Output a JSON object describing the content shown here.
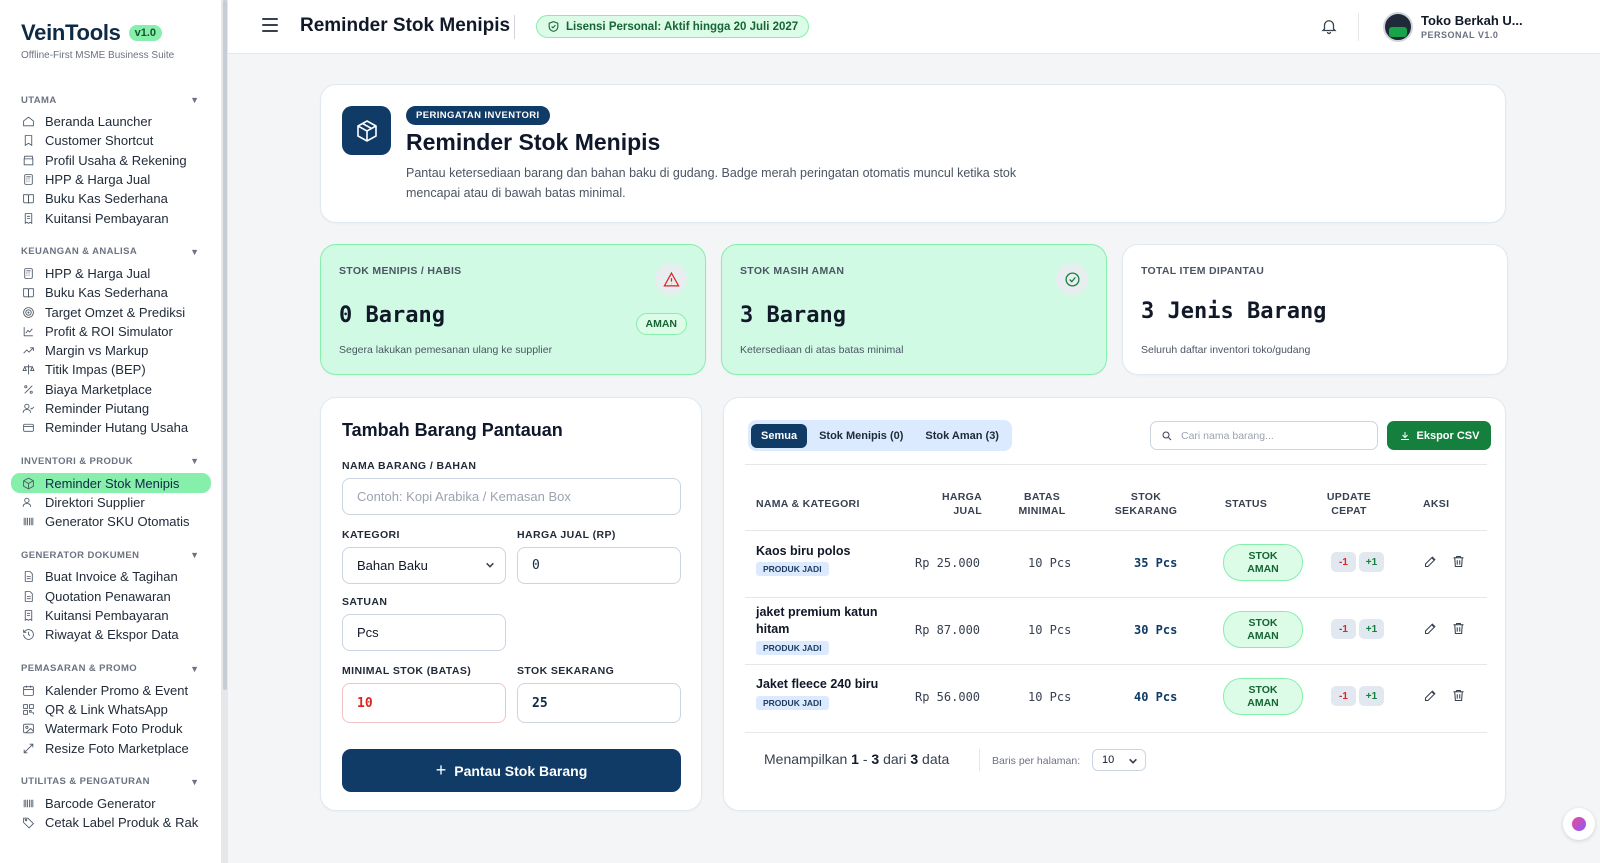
{
  "brand": {
    "name": "VeinTools",
    "version": "v1.0",
    "tagline": "Offline-First MSME Business Suite"
  },
  "sidebar": {
    "sections": [
      {
        "title": "UTAMA",
        "items": [
          "Beranda Launcher",
          "Customer Shortcut",
          "Profil Usaha & Rekening",
          "HPP & Harga Jual",
          "Buku Kas Sederhana",
          "Kuitansi Pembayaran"
        ]
      },
      {
        "title": "KEUANGAN & ANALISA",
        "items": [
          "HPP & Harga Jual",
          "Buku Kas Sederhana",
          "Target Omzet & Prediksi",
          "Profit & ROI Simulator",
          "Margin vs Markup",
          "Titik Impas (BEP)",
          "Biaya Marketplace",
          "Reminder Piutang",
          "Reminder Hutang Usaha"
        ]
      },
      {
        "title": "INVENTORI & PRODUK",
        "items": [
          "Reminder Stok Menipis",
          "Direktori Supplier",
          "Generator SKU Otomatis"
        ]
      },
      {
        "title": "GENERATOR DOKUMEN",
        "items": [
          "Buat Invoice & Tagihan",
          "Quotation Penawaran",
          "Kuitansi Pembayaran",
          "Riwayat & Ekspor Data"
        ]
      },
      {
        "title": "PEMASARAN & PROMO",
        "items": [
          "Kalender Promo & Event",
          "QR & Link WhatsApp",
          "Watermark Foto Produk",
          "Resize Foto Marketplace"
        ]
      },
      {
        "title": "UTILITAS & PENGATURAN",
        "items": [
          "Barcode Generator",
          "Cetak Label Produk & Rak"
        ]
      }
    ]
  },
  "header": {
    "title": "Reminder Stok Menipis",
    "license": "Lisensi Personal: Aktif hingga 20 Juli 2027",
    "user_name": "Toko Berkah U...",
    "user_plan": "PERSONAL V1.0"
  },
  "hero": {
    "tag": "PERINGATAN INVENTORI",
    "title": "Reminder Stok Menipis",
    "description": "Pantau ketersediaan barang dan bahan baku di gudang. Badge merah peringatan otomatis muncul ketika stok mencapai atau di bawah batas minimal."
  },
  "stats": [
    {
      "label": "STOK MENIPIS / HABIS",
      "value": "0 Barang",
      "note": "Segera lakukan pemesanan ulang ke supplier",
      "badge": "AMAN"
    },
    {
      "label": "STOK MASIH AMAN",
      "value": "3 Barang",
      "note": "Ketersediaan di atas batas minimal"
    },
    {
      "label": "TOTAL ITEM DIPANTAU",
      "value": "3 Jenis Barang",
      "note": "Seluruh daftar inventori toko/gudang"
    }
  ],
  "form": {
    "title": "Tambah Barang Pantauan",
    "name_label": "NAMA BARANG / BAHAN",
    "name_placeholder": "Contoh: Kopi Arabika / Kemasan Box",
    "category_label": "KATEGORI",
    "category_value": "Bahan Baku",
    "price_label": "HARGA JUAL (RP)",
    "price_value": "0",
    "unit_label": "SATUAN",
    "unit_value": "Pcs",
    "min_label": "MINIMAL STOK (BATAS)",
    "min_value": "10",
    "stock_label": "STOK SEKARANG",
    "stock_value": "25",
    "submit_label": "Pantau Stok Barang"
  },
  "table": {
    "tabs": [
      "Semua",
      "Stok Menipis (0)",
      "Stok Aman (3)"
    ],
    "search_placeholder": "Cari nama barang...",
    "export_label": "Ekspor CSV",
    "headers": {
      "name": "NAMA & KATEGORI",
      "price": [
        "HARGA",
        "JUAL"
      ],
      "min": [
        "BATAS",
        "MINIMAL"
      ],
      "stock": [
        "STOK",
        "SEKARANG"
      ],
      "status": "STATUS",
      "update": [
        "UPDATE",
        "CEPAT"
      ],
      "action": "AKSI"
    },
    "rows": [
      {
        "name": "Kaos biru polos",
        "category": "PRODUK JADI",
        "price": "Rp 25.000",
        "min": "10 Pcs",
        "stock": "35 Pcs",
        "status_1": "STOK",
        "status_2": "AMAN",
        "minus": "-1",
        "plus": "+1"
      },
      {
        "name": "jaket premium katun hitam",
        "category": "PRODUK JADI",
        "price": "Rp 87.000",
        "min": "10 Pcs",
        "stock": "30 Pcs",
        "status_1": "STOK",
        "status_2": "AMAN",
        "minus": "-1",
        "plus": "+1"
      },
      {
        "name": "Jaket fleece 240 biru",
        "category": "PRODUK JADI",
        "price": "Rp 56.000",
        "min": "10 Pcs",
        "stock": "40 Pcs",
        "status_1": "STOK",
        "status_2": "AMAN",
        "minus": "-1",
        "plus": "+1"
      }
    ],
    "footer": {
      "prefix": "Menampilkan",
      "from": "1",
      "dash": "-",
      "to": "3",
      "of": "dari",
      "total": "3",
      "suffix": "data",
      "per_page_label": "Baris per halaman:",
      "per_page": "10"
    }
  }
}
